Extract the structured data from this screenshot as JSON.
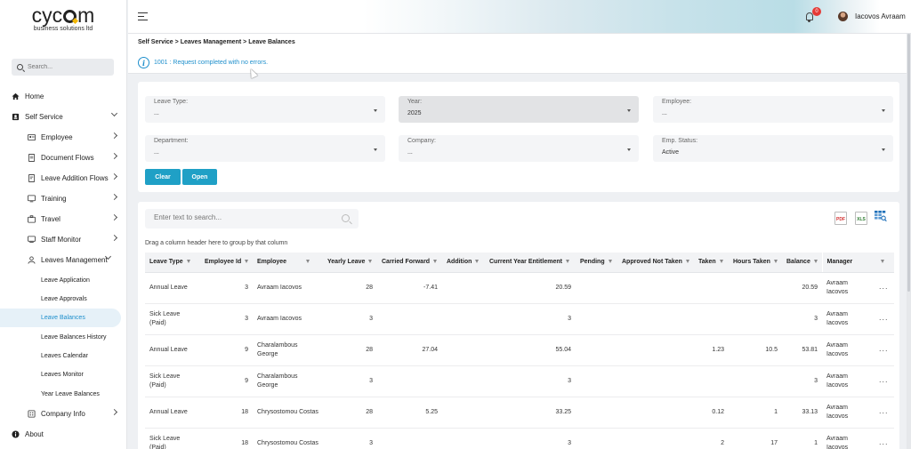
{
  "logo": {
    "brand": "cyc",
    "brand_tail": "m",
    "tagline": "business solutions ltd"
  },
  "sidebar": {
    "search_placeholder": "Search...",
    "items": [
      {
        "label": "Home",
        "icon": "home-icon"
      },
      {
        "label": "Self Service",
        "icon": "self-service-icon"
      },
      {
        "label": "Employee",
        "icon": "employee-icon"
      },
      {
        "label": "Document Flows",
        "icon": "document-icon"
      },
      {
        "label": "Leave Addition Flows",
        "icon": "flow-icon"
      },
      {
        "label": "Training",
        "icon": "training-icon"
      },
      {
        "label": "Travel",
        "icon": "travel-icon"
      },
      {
        "label": "Staff Monitor",
        "icon": "monitor-icon"
      },
      {
        "label": "Leaves Management",
        "icon": "leaves-icon"
      },
      {
        "label": "Company Info",
        "icon": "company-icon"
      },
      {
        "label": "About",
        "icon": "info-icon"
      }
    ],
    "sub_items": [
      "Leave Application",
      "Leave Approvals",
      "Leave Balances",
      "Leave Balances History",
      "Leaves Calendar",
      "Leaves Monitor",
      "Year Leave Balances"
    ]
  },
  "header": {
    "notifications": "0",
    "user": "Iacovos Avraam"
  },
  "breadcrumb": {
    "a": "Self Service",
    "b": "Leaves Management",
    "c": "Leave Balances",
    "sep": ">"
  },
  "message": "1001 : Request completed with no errors.",
  "filters": {
    "leave_type": {
      "label": "Leave Type:",
      "value": "..."
    },
    "year": {
      "label": "Year:",
      "value": "2025"
    },
    "employee": {
      "label": "Employee:",
      "value": "..."
    },
    "department": {
      "label": "Department:",
      "value": "..."
    },
    "company": {
      "label": "Company:",
      "value": "..."
    },
    "emp_status": {
      "label": "Emp. Status:",
      "value": "Active"
    },
    "clear": "Clear",
    "open": "Open"
  },
  "grid": {
    "search_placeholder": "Enter text to search...",
    "export_pdf": "PDF",
    "export_xls": "XLS",
    "group_hint": "Drag a column header here to group by that column",
    "columns": [
      "Leave Type",
      "Employee Id",
      "Employee",
      "Yearly Leave",
      "Carried Forward",
      "Addition",
      "Current Year Entitlement",
      "Pending",
      "Approved Not Taken",
      "Taken",
      "Hours Taken",
      "Balance",
      "Manager"
    ],
    "rows": [
      [
        "Annual Leave",
        "3",
        "Avraam Iacovos",
        "28",
        "-7.41",
        "",
        "20.59",
        "",
        "",
        "",
        "",
        "20.59",
        "Avraam Iacovos"
      ],
      [
        "Sick Leave (Paid)",
        "3",
        "Avraam Iacovos",
        "3",
        "",
        "",
        "3",
        "",
        "",
        "",
        "",
        "3",
        "Avraam Iacovos"
      ],
      [
        "Annual Leave",
        "9",
        "Charalambous George",
        "28",
        "27.04",
        "",
        "55.04",
        "",
        "",
        "1.23",
        "10.5",
        "53.81",
        "Avraam Iacovos"
      ],
      [
        "Sick Leave (Paid)",
        "9",
        "Charalambous George",
        "3",
        "",
        "",
        "3",
        "",
        "",
        "",
        "",
        "3",
        "Avraam Iacovos"
      ],
      [
        "Annual Leave",
        "18",
        "Chrysostomou Costas",
        "28",
        "5.25",
        "",
        "33.25",
        "",
        "",
        "0.12",
        "1",
        "33.13",
        "Avraam Iacovos"
      ],
      [
        "Sick Leave (Paid)",
        "18",
        "Chrysostomou Costas",
        "3",
        "",
        "",
        "3",
        "",
        "",
        "2",
        "17",
        "1",
        "Avraam Iacovos"
      ]
    ],
    "row_menu": "···"
  }
}
